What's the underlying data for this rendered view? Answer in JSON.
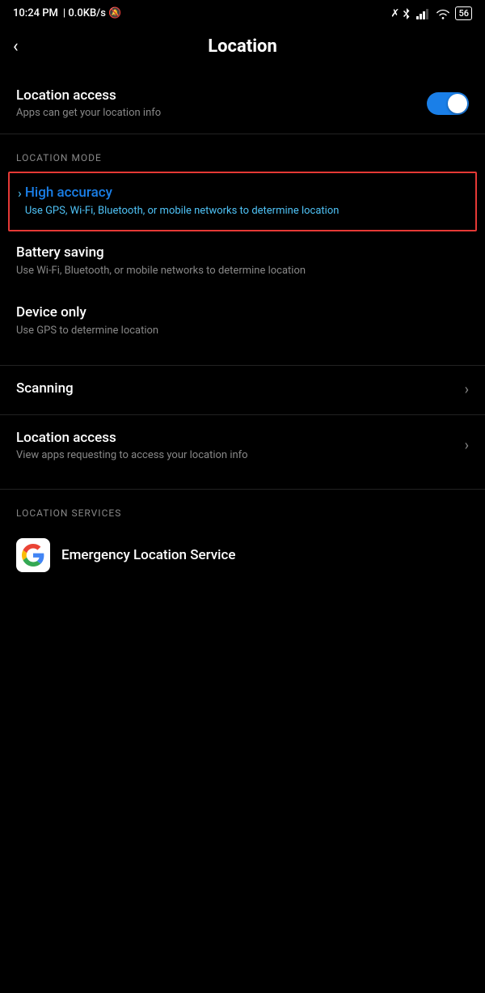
{
  "statusBar": {
    "time": "10:24 PM",
    "network": "0.0KB/s",
    "battery": "56"
  },
  "header": {
    "backLabel": "<",
    "title": "Location"
  },
  "locationAccess": {
    "title": "Location access",
    "subtitle": "Apps can get your location info",
    "toggleOn": true
  },
  "locationMode": {
    "sectionLabel": "LOCATION MODE",
    "modes": [
      {
        "id": "high-accuracy",
        "title": "High accuracy",
        "subtitle": "Use GPS, Wi-Fi, Bluetooth, or mobile networks to determine location",
        "selected": true
      },
      {
        "id": "battery-saving",
        "title": "Battery saving",
        "subtitle": "Use Wi-Fi, Bluetooth, or mobile networks to determine location",
        "selected": false
      },
      {
        "id": "device-only",
        "title": "Device only",
        "subtitle": "Use GPS to determine location",
        "selected": false
      }
    ]
  },
  "navItems": [
    {
      "id": "scanning",
      "title": "Scanning",
      "subtitle": ""
    },
    {
      "id": "location-access-apps",
      "title": "Location access",
      "subtitle": "View apps requesting to access your location info"
    }
  ],
  "locationServices": {
    "sectionLabel": "LOCATION SERVICES",
    "items": [
      {
        "id": "emergency-location",
        "title": "Emergency Location Service",
        "icon": "google"
      }
    ]
  }
}
